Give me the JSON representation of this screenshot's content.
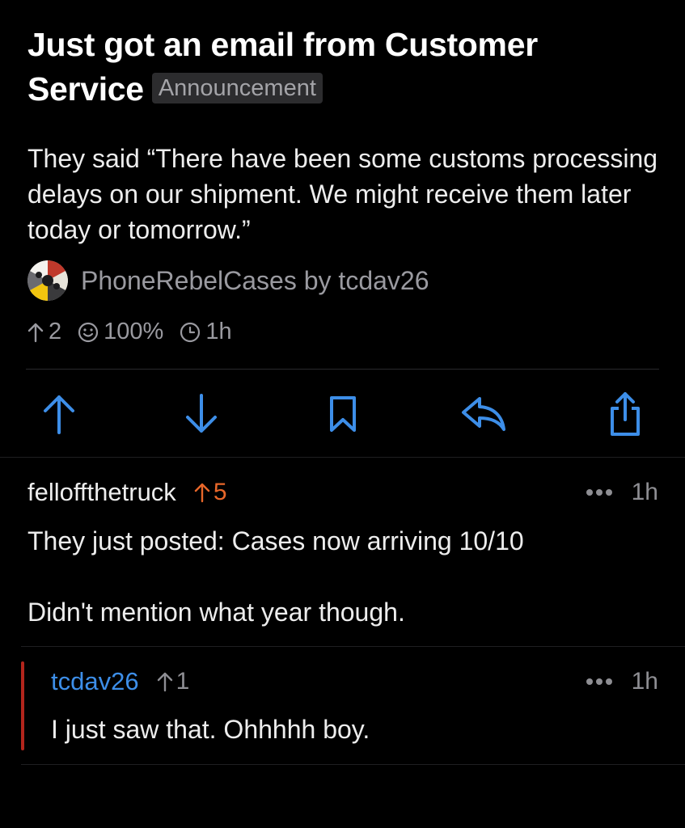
{
  "post": {
    "title": "Just got an email from Customer Service",
    "flair": "Announcement",
    "body": "They said “There have been some customs processing delays on our shipment. We might receive them later today or tomorrow.”",
    "community": "PhoneRebelCases",
    "by_label": "by",
    "author": "tcdav26",
    "score": "2",
    "upvote_ratio": "100%",
    "age": "1h"
  },
  "actions": {
    "upvote_icon": "arrow-up-icon",
    "downvote_icon": "arrow-down-icon",
    "save_icon": "bookmark-icon",
    "reply_icon": "reply-icon",
    "share_icon": "share-icon",
    "accent": "#3d8ee8"
  },
  "comments": [
    {
      "user": "felloffthetruck",
      "score": "5",
      "score_color": "#e8672a",
      "age": "1h",
      "text_line1": "They just posted: Cases now arriving 10/10",
      "text_line2": "Didn't mention what year though."
    },
    {
      "user": "tcdav26",
      "score": "1",
      "score_color": "#8e8e93",
      "age": "1h",
      "text": "I just saw that. Ohhhhh boy.",
      "thread_color": "#b3251c"
    }
  ]
}
